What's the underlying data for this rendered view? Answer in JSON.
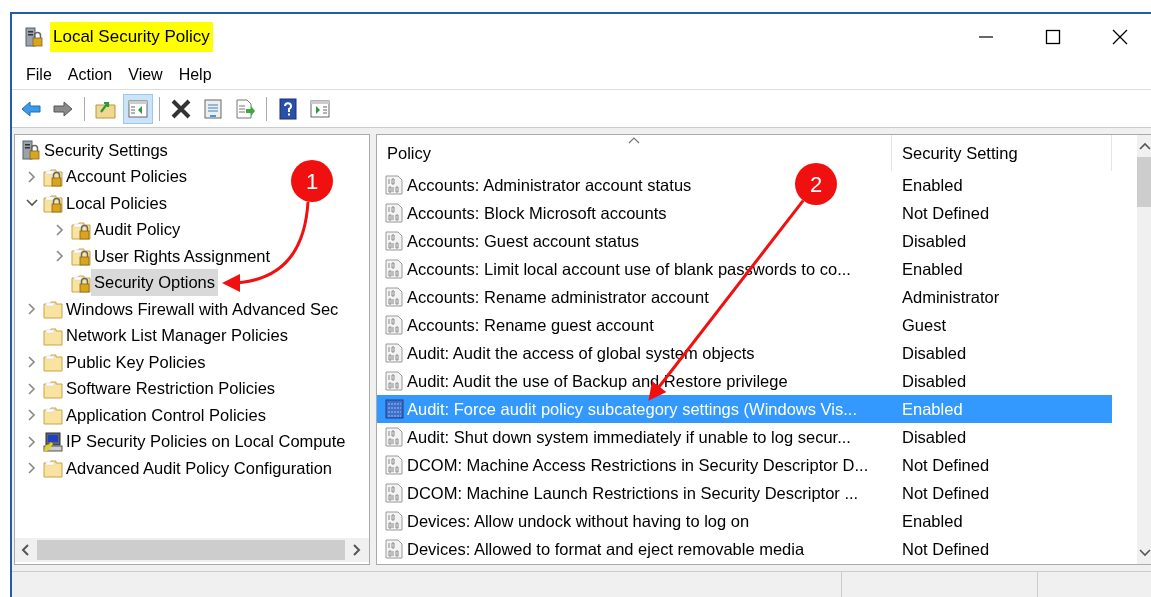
{
  "window": {
    "title": "Local Security Policy",
    "title_highlighted": true
  },
  "menu": [
    "File",
    "Action",
    "View",
    "Help"
  ],
  "toolbar": [
    {
      "kind": "back",
      "pressed": false
    },
    {
      "kind": "forward",
      "pressed": false
    },
    {
      "kind": "sep"
    },
    {
      "kind": "up",
      "pressed": false
    },
    {
      "kind": "tree",
      "pressed": true
    },
    {
      "kind": "sep"
    },
    {
      "kind": "delete",
      "pressed": false
    },
    {
      "kind": "properties",
      "pressed": false
    },
    {
      "kind": "export",
      "pressed": false
    },
    {
      "kind": "sep"
    },
    {
      "kind": "help",
      "pressed": false
    },
    {
      "kind": "pane",
      "pressed": false
    }
  ],
  "tree": [
    {
      "label": "Security Settings",
      "kind": "server",
      "selected": false,
      "children": [
        {
          "label": "Account Policies",
          "kind": "lockfolder",
          "expandable": true,
          "expanded": false,
          "selected": false
        },
        {
          "label": "Local Policies",
          "kind": "lockfolder",
          "expandable": true,
          "expanded": true,
          "selected": false,
          "children": [
            {
              "label": "Audit Policy",
              "kind": "lockfolder",
              "expandable": true,
              "expanded": false,
              "selected": false
            },
            {
              "label": "User Rights Assignment",
              "kind": "lockfolder",
              "expandable": true,
              "expanded": false,
              "selected": false
            },
            {
              "label": "Security Options",
              "kind": "lockfolder",
              "expandable": false,
              "selected": true
            }
          ]
        },
        {
          "label": "Windows Firewall with Advanced Sec",
          "kind": "folder",
          "expandable": true,
          "expanded": false,
          "selected": false
        },
        {
          "label": "Network List Manager Policies",
          "kind": "folder",
          "expandable": false,
          "selected": false
        },
        {
          "label": "Public Key Policies",
          "kind": "folder",
          "expandable": true,
          "expanded": false,
          "selected": false
        },
        {
          "label": "Software Restriction Policies",
          "kind": "folder",
          "expandable": true,
          "expanded": false,
          "selected": false
        },
        {
          "label": "Application Control Policies",
          "kind": "folder",
          "expandable": true,
          "expanded": false,
          "selected": false
        },
        {
          "label": "IP Security Policies on Local Compute",
          "kind": "computer",
          "expandable": true,
          "expanded": false,
          "selected": false
        },
        {
          "label": "Advanced Audit Policy Configuration",
          "kind": "folder",
          "expandable": true,
          "expanded": false,
          "selected": false
        }
      ]
    }
  ],
  "table": {
    "columns": [
      {
        "label": "Policy",
        "sorted": true
      },
      {
        "label": "Security Setting",
        "sorted": false
      }
    ],
    "rows": [
      {
        "policy": "Accounts: Administrator account status",
        "setting": "Enabled",
        "selected": false
      },
      {
        "policy": "Accounts: Block Microsoft accounts",
        "setting": "Not Defined",
        "selected": false
      },
      {
        "policy": "Accounts: Guest account status",
        "setting": "Disabled",
        "selected": false
      },
      {
        "policy": "Accounts: Limit local account use of blank passwords to co...",
        "setting": "Enabled",
        "selected": false
      },
      {
        "policy": "Accounts: Rename administrator account",
        "setting": "Administrator",
        "selected": false
      },
      {
        "policy": "Accounts: Rename guest account",
        "setting": "Guest",
        "selected": false
      },
      {
        "policy": "Audit: Audit the access of global system objects",
        "setting": "Disabled",
        "selected": false
      },
      {
        "policy": "Audit: Audit the use of Backup and Restore privilege",
        "setting": "Disabled",
        "selected": false
      },
      {
        "policy": "Audit: Force audit policy subcategory settings (Windows Vis...",
        "setting": "Enabled",
        "selected": true
      },
      {
        "policy": "Audit: Shut down system immediately if unable to log secur...",
        "setting": "Disabled",
        "selected": false
      },
      {
        "policy": "DCOM: Machine Access Restrictions in Security Descriptor D...",
        "setting": "Not Defined",
        "selected": false
      },
      {
        "policy": "DCOM: Machine Launch Restrictions in Security Descriptor ...",
        "setting": "Not Defined",
        "selected": false
      },
      {
        "policy": "Devices: Allow undock without having to log on",
        "setting": "Enabled",
        "selected": false
      },
      {
        "policy": "Devices: Allowed to format and eject removable media",
        "setting": "Not Defined",
        "selected": false
      }
    ]
  },
  "annotations": [
    {
      "label": "1"
    },
    {
      "label": "2"
    }
  ]
}
